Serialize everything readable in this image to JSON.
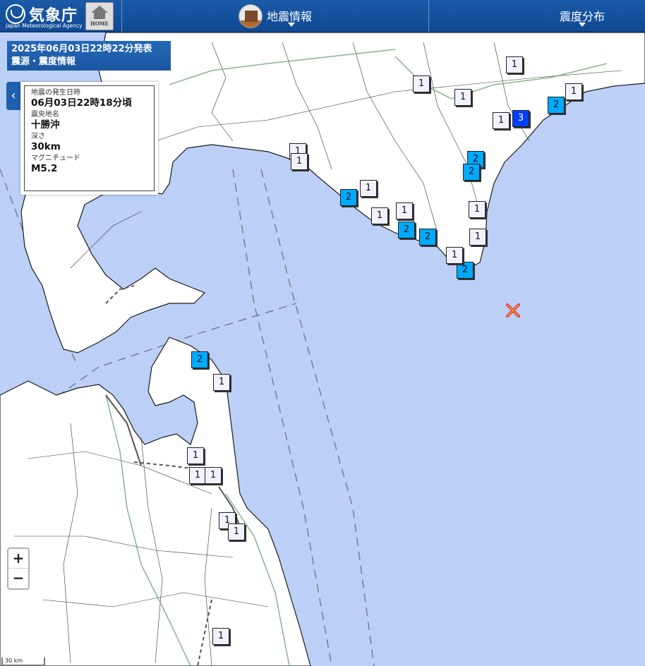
{
  "header": {
    "agency_name": "気象庁",
    "agency_name_en": "Japan Meteorological Agency",
    "home_label": "HOME",
    "menu_earthquake": "地震情報",
    "menu_intensity": "震度分布"
  },
  "banner": {
    "issued": "2025年06月03日22時22分発表",
    "type": "震源・震度情報"
  },
  "info": {
    "occurred_label": "地震の発生日時",
    "occurred": "06月03日22時18分頃",
    "region_label": "震央地名",
    "region": "十勝沖",
    "depth_label": "深さ",
    "depth": "30km",
    "magnitude_label": "マグニチュード",
    "magnitude": "M5.2"
  },
  "intensity_colors": {
    "1": "#f2f2ff",
    "2": "#00aaff",
    "3": "#0041ff"
  },
  "epicenter_marker": {
    "name": "epicenter-x-icon",
    "color": "#e3262b"
  },
  "stations": [
    {
      "intensity": "1"
    },
    {
      "intensity": "1"
    },
    {
      "intensity": "1"
    },
    {
      "intensity": "1"
    },
    {
      "intensity": "1"
    },
    {
      "intensity": "3"
    },
    {
      "intensity": "2"
    },
    {
      "intensity": "1"
    },
    {
      "intensity": "1"
    },
    {
      "intensity": "2"
    },
    {
      "intensity": "2"
    },
    {
      "intensity": "1"
    },
    {
      "intensity": "2"
    },
    {
      "intensity": "1"
    },
    {
      "intensity": "1"
    },
    {
      "intensity": "1"
    },
    {
      "intensity": "2"
    },
    {
      "intensity": "2"
    },
    {
      "intensity": "2"
    },
    {
      "intensity": "1"
    },
    {
      "intensity": "1"
    },
    {
      "intensity": "2"
    },
    {
      "intensity": "1"
    },
    {
      "intensity": "1"
    },
    {
      "intensity": "1"
    },
    {
      "intensity": "1"
    },
    {
      "intensity": "1"
    },
    {
      "intensity": "1"
    },
    {
      "intensity": "1"
    },
    {
      "intensity": "1"
    }
  ],
  "zoom": {
    "in": "+",
    "out": "−"
  },
  "scale_label": "30 km"
}
